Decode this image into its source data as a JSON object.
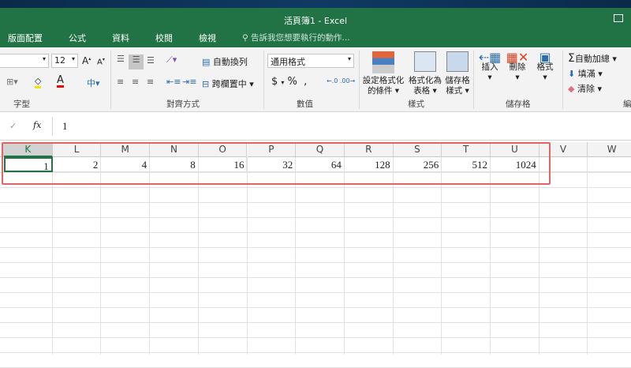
{
  "window": {
    "title": "活頁簿1 - Excel"
  },
  "tabs": [
    {
      "label": "版面配置"
    },
    {
      "label": "公式"
    },
    {
      "label": "資料"
    },
    {
      "label": "校閱"
    },
    {
      "label": "檢視"
    }
  ],
  "tell_me": "告訴我您想要執行的動作...",
  "ribbon": {
    "font_size": "12",
    "wrap_text": "自動換列",
    "merge_center": "跨欄置中",
    "number_format": "通用格式",
    "conditional_format": [
      "設定格式化",
      "的條件"
    ],
    "format_table": [
      "格式化為",
      "表格"
    ],
    "cell_styles": [
      "儲存格",
      "樣式"
    ],
    "insert": "插入",
    "delete": "刪除",
    "format": "格式",
    "autosum": "自動加總",
    "fill": "填滿",
    "clear": "清除",
    "groups": {
      "font": "字型",
      "alignment": "對齊方式",
      "number": "數值",
      "styles": "樣式",
      "cells": "儲存格",
      "editing": "編"
    }
  },
  "formula_bar": {
    "fx": "fx",
    "value": "1"
  },
  "columns": [
    "K",
    "L",
    "M",
    "N",
    "O",
    "P",
    "Q",
    "R",
    "S",
    "T",
    "U",
    "V",
    "W"
  ],
  "row1": [
    "1",
    "2",
    "4",
    "8",
    "16",
    "32",
    "64",
    "128",
    "256",
    "512",
    "1024",
    "",
    ""
  ],
  "colors": {
    "green": "#217346",
    "highlight_box": "#e06666",
    "active_cell": "#217346"
  }
}
